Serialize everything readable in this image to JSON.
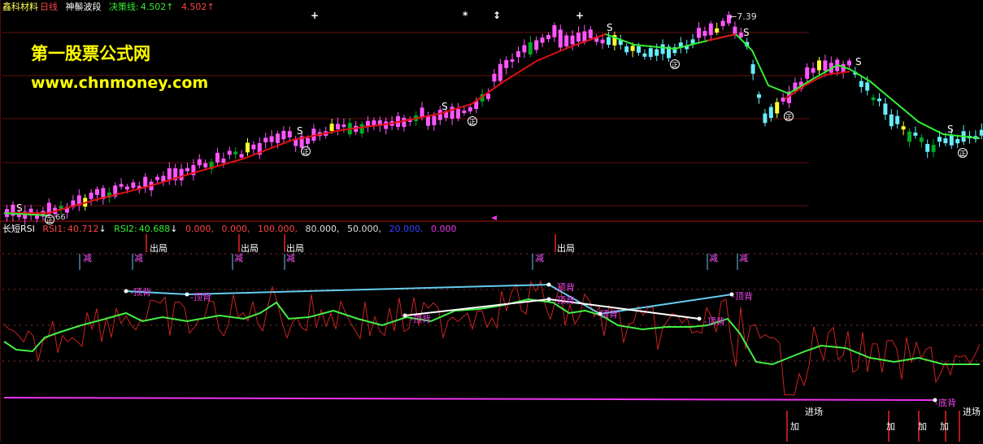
{
  "header_top": {
    "stock_name": "鑫科材料",
    "period": "日线",
    "indicator": "神鬃波段",
    "decision_label": "决策线:",
    "decision_value_1": "4.502",
    "decision_value_2": "4.502",
    "up_arrow": "↑",
    "price_high_label": "7.39",
    "price_low_label": "66",
    "s_mark": "S",
    "zheng_mark": "正"
  },
  "watermark": {
    "line1": "第一股票公式网",
    "line2": "www.chnmoney.com"
  },
  "header_bottom": {
    "indicator_name": "长短RSI",
    "rsi1_label": "RSI1:",
    "rsi1_value": "40.712",
    "rsi2_label": "RSI2:",
    "rsi2_value": "40.688",
    "down_arrow": "↓",
    "params": [
      "0.000,",
      "0.000,",
      "100.000,",
      "80.000,",
      "50.000,",
      "20.000,",
      "0.000"
    ]
  },
  "signals": {
    "reduce": "减",
    "exit": "出局",
    "top_div": "顶背",
    "bottom_div": "底背",
    "enter": "进场",
    "add": "加"
  },
  "colors": {
    "bg": "#000000",
    "up_candle": "#ff55ff",
    "down_candle": "#66eeff",
    "green_candle": "#00aa22",
    "yellow_candle": "#ffff33",
    "ma_red": "#dd1111",
    "ma_green": "#33ee33",
    "rsi_red": "#cc2222",
    "rsi_green": "#44ee44",
    "div_cyan": "#66ccee",
    "div_white": "#ffffff",
    "magenta_line": "#ee33ee",
    "grid_red": "#661111"
  }
}
